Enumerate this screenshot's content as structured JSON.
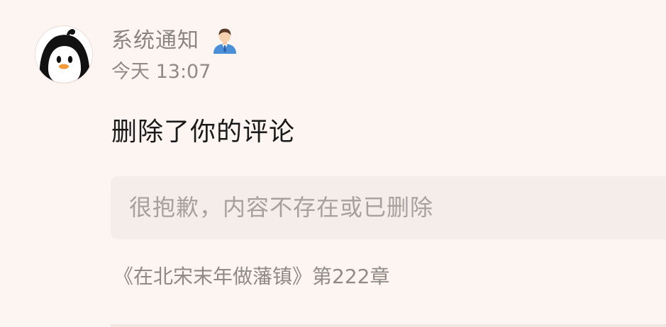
{
  "notification": {
    "sender_name": "系统通知",
    "avatar_icon": "penguin-avatar-icon",
    "badge_icon": "official-person-icon",
    "timestamp": "今天 13:07",
    "message": "删除了你的评论",
    "quoted_text": "很抱歉，内容不存在或已删除",
    "source": "《在北宋末年做藩镇》第222章"
  },
  "colors": {
    "background": "#fdf5f2",
    "quote_background": "#f4edea",
    "primary_text": "#1a1a1a",
    "secondary_text": "#8a8582",
    "muted_text": "#a7a09d"
  }
}
